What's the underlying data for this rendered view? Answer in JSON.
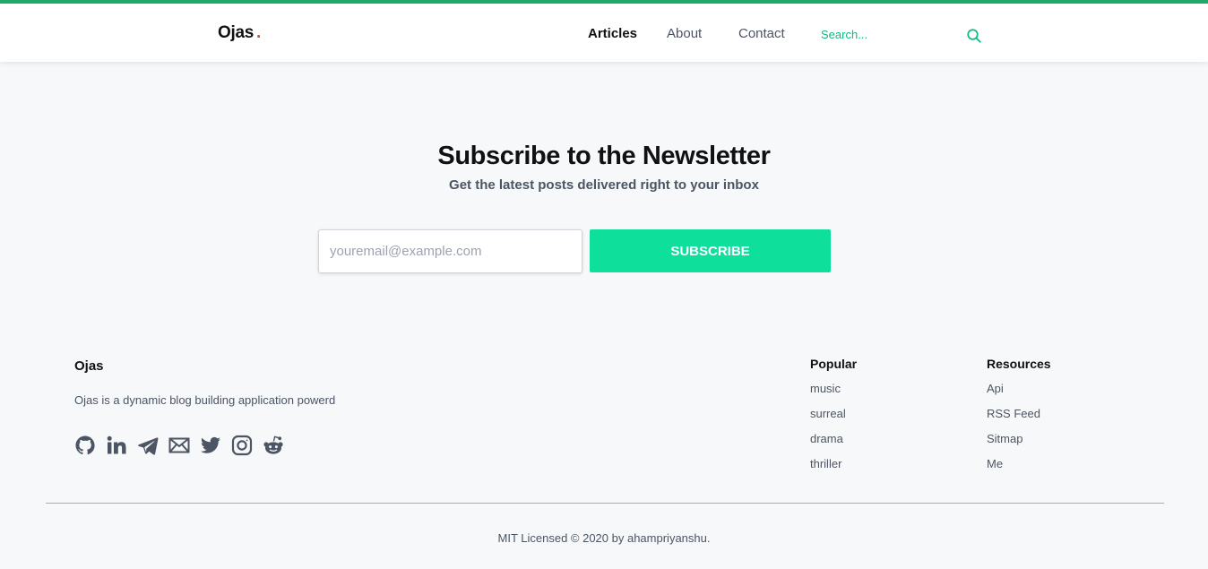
{
  "header": {
    "brand": "Ojas",
    "brand_dot": ".",
    "nav": [
      {
        "label": "Articles",
        "active": true
      },
      {
        "label": "About",
        "active": false
      },
      {
        "label": "Contact",
        "active": false
      }
    ],
    "search_placeholder": "Search...",
    "search_icon": "search-icon"
  },
  "newsletter": {
    "title": "Subscribe to the Newsletter",
    "subtitle": "Get the latest posts delivered right to your inbox",
    "email_placeholder": "youremail@example.com",
    "email_value": "",
    "button_label": "SUBSCRIBE"
  },
  "footer": {
    "brand": "Ojas",
    "description": "Ojas is a dynamic blog building application powerd",
    "socials": [
      "github-icon",
      "linkedin-icon",
      "telegram-icon",
      "mail-icon",
      "twitter-icon",
      "instagram-icon",
      "reddit-icon"
    ],
    "popular": {
      "title": "Popular",
      "links": [
        "music",
        "surreal",
        "drama",
        "thriller"
      ]
    },
    "resources": {
      "title": "Resources",
      "links": [
        "Api",
        "RSS Feed",
        "Sitmap",
        "Me"
      ]
    },
    "license": "MIT Licensed © 2020 by ahampriyanshu."
  },
  "colors": {
    "accent": "#0ee09b",
    "top_border": "#1fa868",
    "brand_dot": "#e0493b",
    "search_text": "#10b981",
    "icon_gray": "#4b5563"
  }
}
